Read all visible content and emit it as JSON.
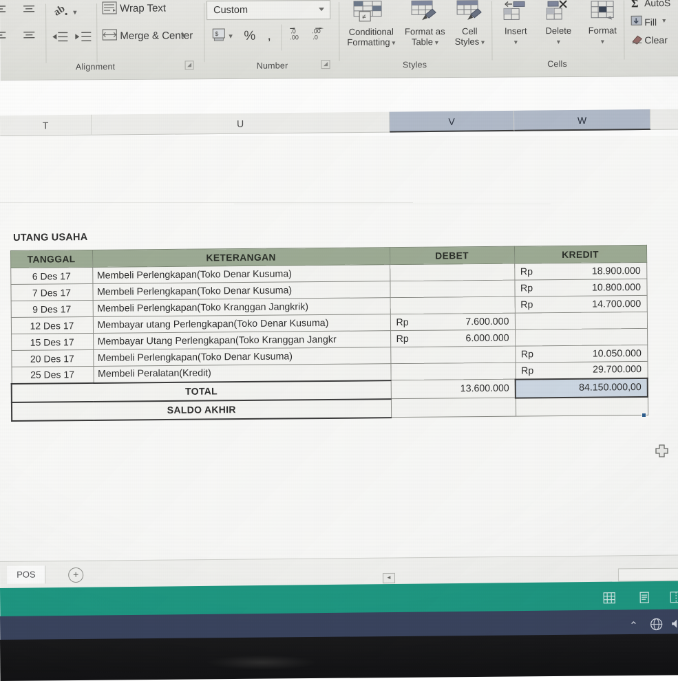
{
  "ribbon": {
    "groups": [
      {
        "name": "Alignment",
        "label": "Alignment"
      },
      {
        "name": "Number",
        "label": "Number"
      },
      {
        "name": "Styles",
        "label": "Styles"
      },
      {
        "name": "Cells",
        "label": "Cells"
      },
      {
        "name": "Editing",
        "label": ""
      }
    ],
    "alignment": {
      "wrap_text": "Wrap Text",
      "merge_center": "Merge & Center",
      "orientation_icon": "text-orientation-icon",
      "decrease_indent_icon": "decrease-indent-icon",
      "increase_indent_icon": "increase-indent-icon",
      "align_icons": [
        "align-top-icon",
        "align-middle-icon",
        "align-left-icon",
        "align-center-icon"
      ],
      "launcher": "dialog-launcher"
    },
    "number": {
      "format_value": "Custom",
      "accounting_icon": "accounting-format-icon",
      "percent": "%",
      "comma": ",",
      "decrease_decimal_icon": "decrease-decimal-icon",
      "increase_decimal_icon": "increase-decimal-icon",
      "launcher": "dialog-launcher"
    },
    "styles": {
      "conditional_formatting_l1": "Conditional",
      "conditional_formatting_l2": "Formatting",
      "format_as_table_l1": "Format as",
      "format_as_table_l2": "Table",
      "cell_styles_l1": "Cell",
      "cell_styles_l2": "Styles"
    },
    "cells": {
      "insert": "Insert",
      "delete": "Delete",
      "format": "Format"
    },
    "editing": {
      "autosum": "AutoS",
      "fill": "Fill",
      "clear": "Clear"
    }
  },
  "grid": {
    "column_headers": [
      {
        "letter": "T",
        "selected": false
      },
      {
        "letter": "U",
        "selected": false
      },
      {
        "letter": "V",
        "selected": true
      },
      {
        "letter": "W",
        "selected": true
      }
    ]
  },
  "table": {
    "title": "UTANG USAHA",
    "columns": [
      "TANGGAL",
      "KETERANGAN",
      "DEBET",
      "KREDIT"
    ],
    "currency_symbol": "Rp",
    "rows": [
      {
        "date": "6 Des 17",
        "desc": "Membeli Perlengkapan(Toko Denar Kusuma)",
        "debet": "",
        "kredit": "18.900.000"
      },
      {
        "date": "7 Des 17",
        "desc": "Membeli Perlengkapan(Toko Denar Kusuma)",
        "debet": "",
        "kredit": "10.800.000"
      },
      {
        "date": "9 Des 17",
        "desc": "Membeli Perlengkapan(Toko Kranggan Jangkrik)",
        "debet": "",
        "kredit": "14.700.000"
      },
      {
        "date": "12 Des 17",
        "desc": "Membayar utang Perlengkapan(Toko Denar Kusuma)",
        "debet": "7.600.000",
        "kredit": ""
      },
      {
        "date": "15 Des 17",
        "desc": "Membayar Utang Perlengkapan(Toko Kranggan Jangkr",
        "debet": "6.000.000",
        "kredit": ""
      },
      {
        "date": "20 Des 17",
        "desc": "Membeli Perlengkapan(Toko Denar Kusuma)",
        "debet": "",
        "kredit": "10.050.000"
      },
      {
        "date": "25 Des 17",
        "desc": "Membeli Peralatan(Kredit)",
        "debet": "",
        "kredit": "29.700.000"
      }
    ],
    "total": {
      "label": "TOTAL",
      "debet": "13.600.000",
      "kredit": "84.150.000,00"
    },
    "saldo": {
      "label": "SALDO AKHIR",
      "debet": "",
      "kredit": ""
    },
    "header_color": "#9fad96",
    "selection_color": "#cfdae6"
  },
  "sheet_tabs": {
    "active_tab": "POS",
    "add_sheet_label": "+"
  },
  "status_bar": {
    "color": "#1f9a84",
    "view_icons": [
      "normal-view-icon",
      "page-layout-icon",
      "page-break-icon"
    ]
  },
  "taskbar": {
    "color": "#3b4560",
    "tray_icons": [
      "show-hidden-icons-chevron",
      "network-icon",
      "volume-icon"
    ]
  }
}
